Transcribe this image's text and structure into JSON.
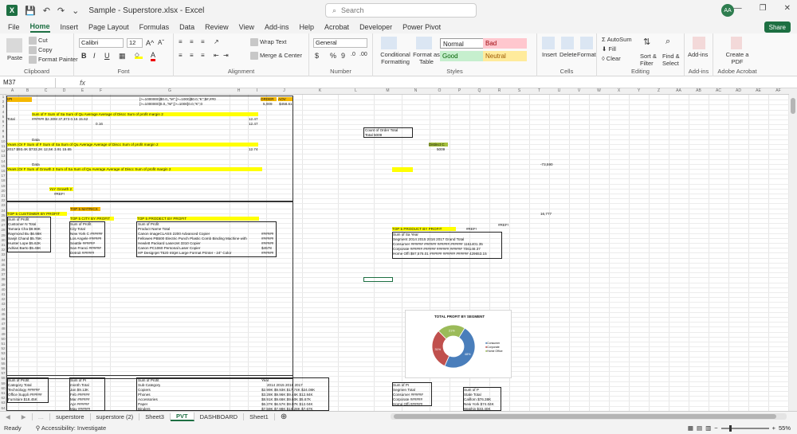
{
  "title": {
    "doc": "Sample - Superstore.xlsx  -  Excel",
    "search": "Search",
    "user": "AA",
    "minimize": "—",
    "restore": "❐",
    "close": "✕"
  },
  "menu": [
    "File",
    "Home",
    "Insert",
    "Page Layout",
    "Formulas",
    "Data",
    "Review",
    "View",
    "Add-ins",
    "Help",
    "Acrobat",
    "Developer",
    "Power Pivot"
  ],
  "share": "Share",
  "ribbon": {
    "clipboard": {
      "label": "Clipboard",
      "paste": "Paste",
      "cut": "Cut",
      "copy": "Copy",
      "painter": "Format Painter"
    },
    "font": {
      "label": "Font",
      "name": "Calibri",
      "size": "12",
      "bold": "B",
      "italic": "I",
      "underline": "U"
    },
    "alignment": {
      "label": "Alignment",
      "wrap": "Wrap Text",
      "merge": "Merge & Center"
    },
    "number": {
      "label": "Number",
      "format": "General",
      "currency": "$",
      "percent": "%",
      "comma": "9"
    },
    "styles": {
      "label": "Styles",
      "cond": "Conditional Formatting",
      "table": "Format as Table",
      "normal": "Normal",
      "bad": "Bad",
      "good": "Good",
      "neutral": "Neutral"
    },
    "cells": {
      "label": "Cells",
      "insert": "Insert",
      "delete": "Delete",
      "format": "Format"
    },
    "editing": {
      "label": "Editing",
      "autosum": "AutoSum",
      "fill": "Fill",
      "clear": "Clear",
      "sort": "Sort & Filter",
      "find": "Find & Select"
    },
    "addins": {
      "label": "Add-ins",
      "addins": "Add-ins"
    },
    "acrobat": {
      "label": "Adobe Acrobat",
      "create": "Create a PDF"
    }
  },
  "formula_bar": {
    "cell": "M37",
    "fx": "fx",
    "value": ""
  },
  "columns": [
    "A",
    "B",
    "C",
    "D",
    "E",
    "F",
    "G",
    "H",
    "I",
    "J",
    "K",
    "L",
    "M",
    "N",
    "O",
    "P",
    "Q",
    "R",
    "S",
    "T",
    "U",
    "V",
    "W",
    "X",
    "Y",
    "Z",
    "AA",
    "AB",
    "AC",
    "AD",
    "AE",
    "AF",
    "AG"
  ],
  "rows": [
    "1",
    "2",
    "3",
    "4",
    "5",
    "6",
    "7",
    "8",
    "9",
    "10",
    "11",
    "12",
    "13",
    "14",
    "15",
    "16",
    "17",
    "18",
    "19",
    "20",
    "21",
    "22",
    "23",
    "24",
    "25",
    "26",
    "27",
    "28",
    "29",
    "30",
    "31",
    "32",
    "33",
    "34",
    "35",
    "36",
    "37",
    "38",
    "39",
    "40",
    "41",
    "42",
    "43",
    "44",
    "45",
    "46",
    "47",
    "48",
    "49",
    "50",
    "51",
    "52",
    "53",
    "54",
    "55",
    "56",
    "57",
    "58",
    "59",
    "60",
    "61",
    "62",
    "63",
    "64"
  ],
  "cells": {
    "kpi": "KPI",
    "formula1": "[>=1000000]$0.0,,\"M\";[>=1000]$0.0,\"K\";$#,##0",
    "formula2": "[>=1000000]0.0,,\"M\";[>=1000]0.0,\"K\";0",
    "order": "ORDER",
    "aov": "AOV",
    "order_v": "5,009",
    "aov_v": "$458.61",
    "hdr1": "Sum of F Sum of Sa Sum of Qu Average Average of Discc Sum of profit margin 2",
    "total": "Total",
    "r5": "######   $2.30M      37,873       0.16          15.62",
    "r5b": "12.47",
    "r6": "0.16",
    "r6b": "12.47",
    "data1": "Data",
    "hdr2": "Years (Or F Sum of F Sum of Sa Sum of Qu Average Average of Discc Sum of profit margin 2",
    "r10": "2017        $93.4K      $733.2K     12,5K       3.91          15.65",
    "r10b": "12.74",
    "data2": "Data",
    "hdr3": "Years (Or F Sum of Growth 2 Sum of Sa Sum of Qu Average Average of Discc Sum of profit margin 2",
    "yoy": "YoY Growth 2",
    "ref": "#REF!",
    "top5matrix": "TOP 5 MATRICX",
    "top5cust": "TOP 5 CUSTOMER BY PROFIT",
    "top5city": "TOP 5 CITY BY PROFIT",
    "top5prod": "TOP 5 PRODECT BY PROFIT",
    "sumprofit": "Sum of Profit",
    "customer": "Customer N Total",
    "city": "City         Total",
    "product": "Product Name                                         Total",
    "cust_rows": [
      "Tamara Cha  $8.98K",
      "Raymond Bu $6.98K",
      "Sanjit Chand $5.76K",
      "Hunter Lope $5.62K",
      "Adrian Barto $5.45K"
    ],
    "city_rows": [
      "New York C ######",
      "Los Angele ######",
      "Seattle      ######",
      "San Franci  ######",
      "Detroit       ######"
    ],
    "prod_rows": [
      "Canon imageCLASS 2200 Advanced Copier",
      "Fellowes PB500 Electric Punch Plastic Comb Binding Machine with",
      "Hewlett Packard LaserJet 3310 Copier",
      "Canon PC1060 Personal Laser Copier",
      "HP Designjet T520 Inkjet Large Format Printer - 24\" Color"
    ],
    "prod_vals": [
      "######",
      "######",
      "######",
      "$4578",
      "######"
    ],
    "countorder": "Count of Order Total",
    "countorder_v": "Total            5009",
    "distinct": "Distinct C",
    "distinct_v": "5009",
    "top5prod2": "TOP 5 PRODUCT BY PROFIT",
    "refM": "#REF!",
    "refT": "#REF!",
    "v73": "-73,590",
    "v16": "16,777",
    "seg_hdr": "Sum of Sa Year",
    "seg_sub": "Segment    2014      2015      2016      2017 Grand Total",
    "seg_rows": [
      "Consumer ######  ######  ######  ######  1161401.35",
      "Corporate ######  ######  ######  ######  706146.37",
      "Home Offi  $97,576.01  ######  ######  ######  429653.15"
    ],
    "b_hdr1": "Sum of Profit",
    "b_cat": "Category  Total",
    "b_cat_rows": [
      "Technology ######",
      "Office Suppli ######",
      "Furniture    $18.45K"
    ],
    "b_month_hdr": "Sum of Pr",
    "b_month": "month    Total",
    "b_month_rows": [
      "Jan       $9.13K",
      "Feb       ######",
      "Mar       ######",
      "Apr       ######",
      "May       ######"
    ],
    "b_sub_hdr": "Sum of Profit",
    "b_year": "Year",
    "b_sub": "Sub-Category",
    "b_years": "2014        2015        2016        2017",
    "b_sub_rows": [
      "Copiers",
      "Phones",
      "Accessories",
      "Paper",
      "Binders"
    ],
    "b_sub_vals": [
      "$2.99K   $9.93K   $17.74K   $24.08K",
      "$3.28K   $9.96K   $9.46K   $12.84K",
      "$8.91K   $9.66K   $9.60K   $5.67K",
      "$6.37K   $6.57K   $9.07K   $12.04K",
      "$7.59K   $7.98K   $10.28K   $7.67K"
    ],
    "b_seg_hdr": "Sum of Pr",
    "b_seg": "Segmen  Total",
    "b_seg_rows": [
      "Consumer ######",
      "Corporate ######",
      "Home Offi ######"
    ],
    "b_state_hdr": "Sum of P",
    "b_state": "State  Total",
    "b_state_rows": [
      "Californ  $76.38K",
      "New York $74.04K",
      "Washin   $33.40K"
    ]
  },
  "chart": {
    "title": "TOTAL PROFIT BY SEGMENT",
    "legend": [
      "Consumer",
      "Corporate",
      "Home Office"
    ],
    "labels": [
      "48%",
      "31%",
      "21%"
    ]
  },
  "chart_data": {
    "type": "pie",
    "title": "TOTAL PROFIT BY SEGMENT",
    "categories": [
      "Consumer",
      "Corporate",
      "Home Office"
    ],
    "values": [
      48,
      31,
      21
    ],
    "colors": [
      "#4a7ebb",
      "#c0504d",
      "#9bbb59"
    ],
    "donut": true,
    "legend_position": "right"
  },
  "sheet_tabs": [
    "superstore",
    "superstore (2)",
    "Sheet3",
    "PVT",
    "DASHBOARD",
    "Sheet1"
  ],
  "active_tab": "PVT",
  "status": {
    "ready": "Ready",
    "accessibility": "Accessibility: Investigate",
    "zoom": "55%"
  }
}
